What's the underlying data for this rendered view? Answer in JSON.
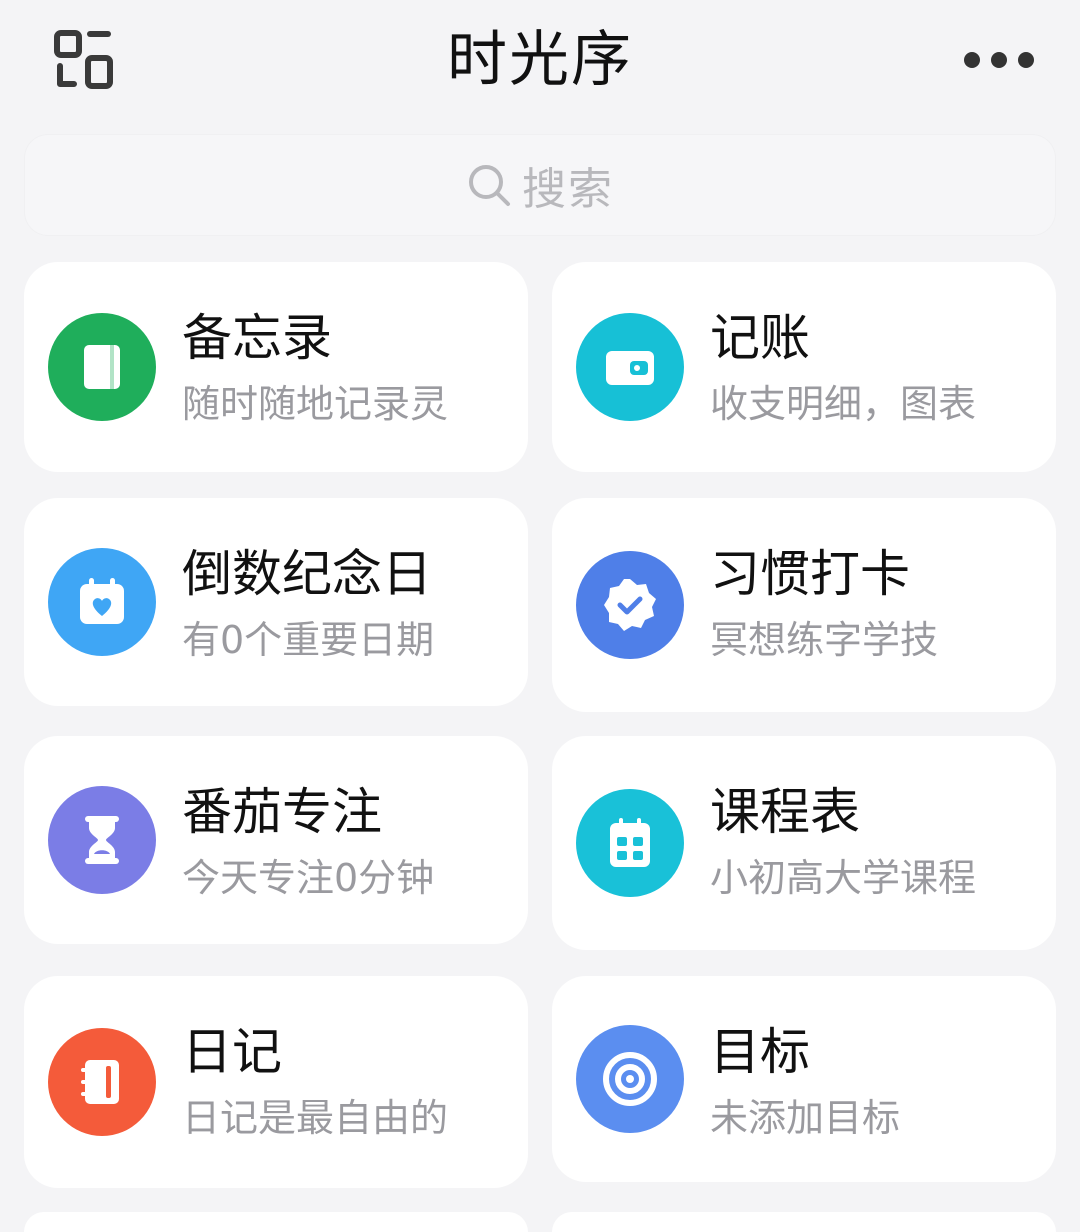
{
  "header": {
    "title": "时光序"
  },
  "search": {
    "placeholder": "搜索"
  },
  "cards": [
    {
      "title": "备忘录",
      "subtitle": "随时随地记录灵",
      "icon": "notebook-icon",
      "color": "#1fae5b"
    },
    {
      "title": "记账",
      "subtitle": "收支明细，图表",
      "icon": "wallet-icon",
      "color": "#17c0d6"
    },
    {
      "title": "倒数纪念日",
      "subtitle": "有0个重要日期",
      "icon": "calendar-heart-icon",
      "color": "#3fa6f5"
    },
    {
      "title": "习惯打卡",
      "subtitle": "冥想练字学技",
      "icon": "badge-check-icon",
      "color": "#4f7fe8"
    },
    {
      "title": "番茄专注",
      "subtitle": "今天专注0分钟",
      "icon": "hourglass-icon",
      "color": "#7b7de6"
    },
    {
      "title": "课程表",
      "subtitle": "小初高大学课程",
      "icon": "timetable-icon",
      "color": "#19c1d8"
    },
    {
      "title": "日记",
      "subtitle": "日记是最自由的",
      "icon": "diary-icon",
      "color": "#f45b3a"
    },
    {
      "title": "目标",
      "subtitle": "未添加目标",
      "icon": "target-icon",
      "color": "#5b8ef0"
    }
  ]
}
